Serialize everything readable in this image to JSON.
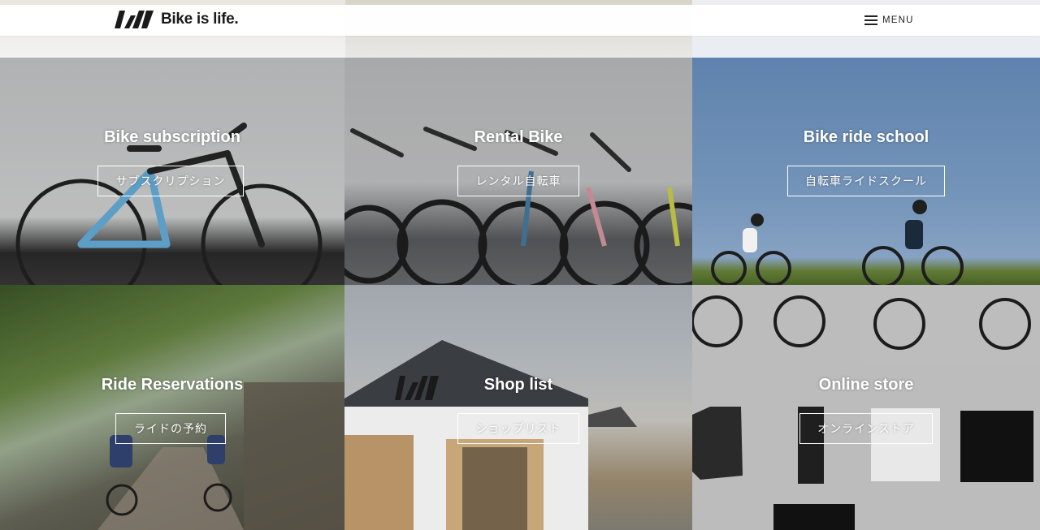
{
  "header": {
    "brand": "Bike is life.",
    "menu_label": "MENU"
  },
  "tiles": [
    {
      "title": "Bike subscription",
      "button": "サブスクリプション"
    },
    {
      "title": "Rental Bike",
      "button": "レンタル自転車"
    },
    {
      "title": "Bike ride school",
      "button": "自転車ライドスクール"
    },
    {
      "title": "Ride Reservations",
      "button": "ライドの予約"
    },
    {
      "title": "Shop list",
      "button": "ショップリスト"
    },
    {
      "title": "Online store",
      "button": "オンラインストア"
    }
  ],
  "icons": {
    "brand_logo": "brand-logo-icon",
    "menu": "hamburger-menu-icon"
  }
}
